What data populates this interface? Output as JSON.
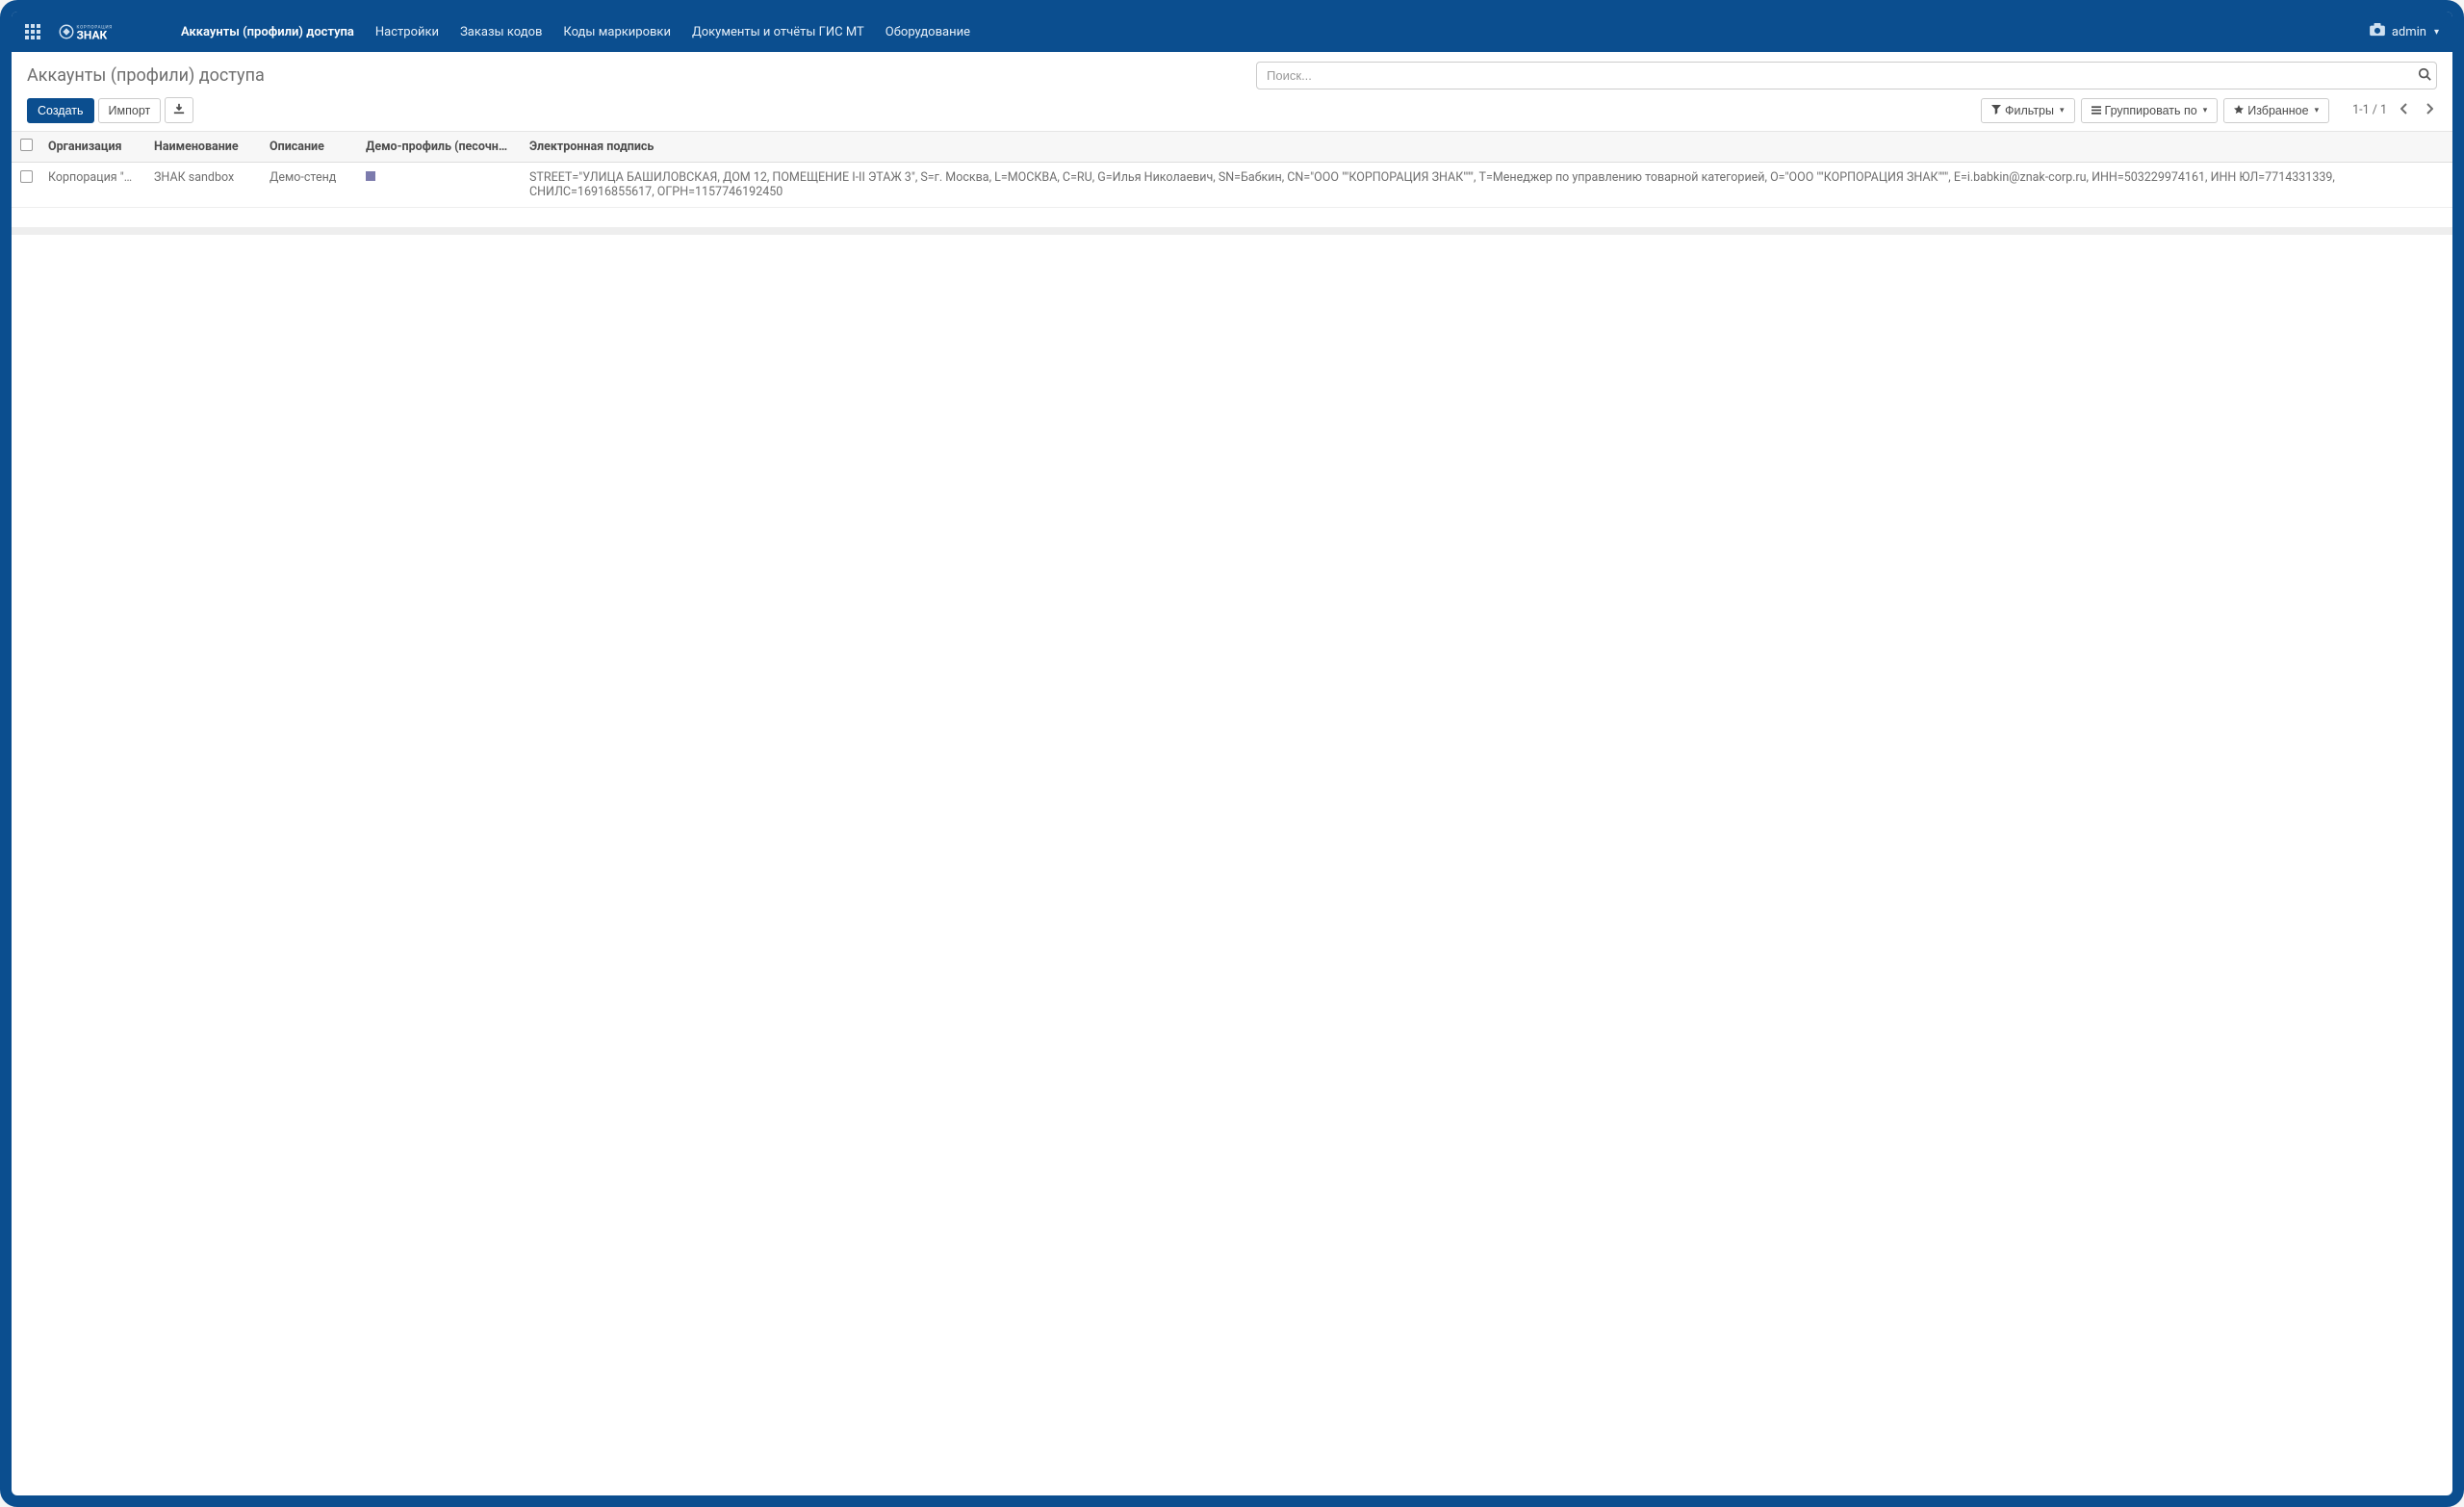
{
  "brand": {
    "name": "ЗНАК",
    "tagline": "КОРПОРАЦИЯ"
  },
  "nav": {
    "items": [
      {
        "label": "Аккаунты (профили) доступа",
        "active": true
      },
      {
        "label": "Настройки"
      },
      {
        "label": "Заказы кодов"
      },
      {
        "label": "Коды маркировки"
      },
      {
        "label": "Документы и отчёты ГИС МТ"
      },
      {
        "label": "Оборудование"
      }
    ],
    "user": "admin"
  },
  "breadcrumb": "Аккаунты (профили) доступа",
  "search": {
    "placeholder": "Поиск..."
  },
  "toolbar": {
    "create": "Создать",
    "import": "Импорт",
    "filters": "Фильтры",
    "group_by": "Группировать по",
    "favorites": "Избранное"
  },
  "pager": {
    "range": "1-1 / 1"
  },
  "table": {
    "columns": [
      "Организация",
      "Наименование",
      "Описание",
      "Демо-профиль (песочница...",
      "Электронная подпись"
    ],
    "rows": [
      {
        "org": "Корпорация \"Зн...",
        "name": "ЗНАК sandbox",
        "desc": "Демо-стенд",
        "demo": true,
        "sig": "STREET=\"УЛИЦА БАШИЛОВСКАЯ, ДОМ 12, ПОМЕЩЕНИЕ I-II ЭТАЖ 3\", S=г. Москва, L=МОСКВА, C=RU, G=Илья Николаевич, SN=Бабкин, CN=\"ООО \"\"КОРПОРАЦИЯ ЗНАК\"\"\", T=Менеджер по управлению товарной категорией, O=\"ООО \"\"КОРПОРАЦИЯ ЗНАК\"\"\", E=i.babkin@znak-corp.ru, ИНН=503229974161, ИНН ЮЛ=7714331339, СНИЛС=16916855617, ОГРН=1157746192450"
      }
    ]
  }
}
